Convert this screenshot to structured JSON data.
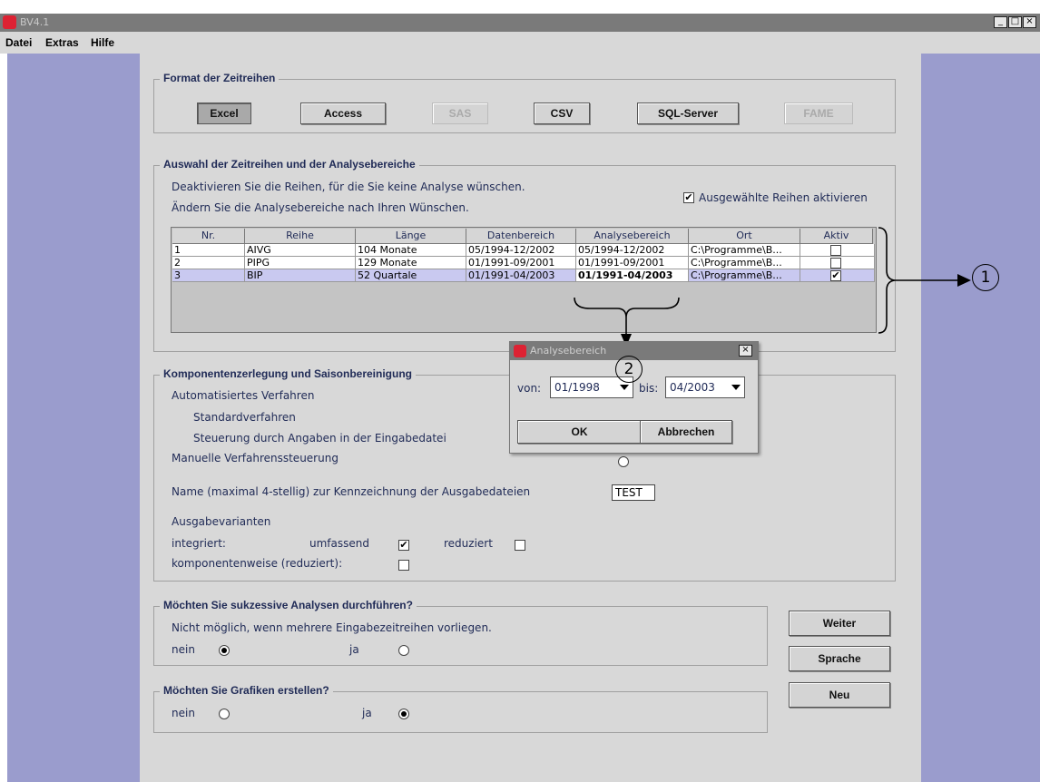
{
  "window": {
    "title": "BV4.1",
    "min": "_",
    "max": "□",
    "close": "×"
  },
  "menu": [
    "Datei",
    "Extras",
    "Hilfe"
  ],
  "format": {
    "title": "Format der Zeitreihen",
    "buttons": [
      "Excel",
      "Access",
      "SAS",
      "CSV",
      "SQL-Server",
      "FAME"
    ]
  },
  "selection": {
    "title": "Auswahl der Zeitreihen und der Analysebereiche",
    "line1": "Deaktivieren Sie die Reihen, für die Sie keine Analyse wünschen.",
    "line2": "Ändern Sie die Analysebereiche nach Ihren Wünschen.",
    "activate_label": "Ausgewählte Reihen aktivieren",
    "columns": [
      "Nr.",
      "Reihe",
      "Länge",
      "Datenbereich",
      "Analysebereich",
      "Ort",
      "Aktiv"
    ],
    "rows": [
      {
        "nr": "1",
        "reihe": "AIVG",
        "laenge": "104 Monate",
        "daten": "05/1994-12/2002",
        "analyse": "05/1994-12/2002",
        "ort": "C:\\Programme\\B...",
        "aktiv": false
      },
      {
        "nr": "2",
        "reihe": "PIPG",
        "laenge": "129 Monate",
        "daten": "01/1991-09/2001",
        "analyse": "01/1991-09/2001",
        "ort": "C:\\Programme\\B...",
        "aktiv": false
      },
      {
        "nr": "3",
        "reihe": "BIP",
        "laenge": "52 Quartale",
        "daten": "01/1991-04/2003",
        "analyse": "01/1991-04/2003",
        "ort": "C:\\Programme\\B...",
        "aktiv": true
      }
    ]
  },
  "komponenten": {
    "title": "Komponentenzerlegung und Saisonbereinigung",
    "auto": "Automatisiertes Verfahren",
    "standard": "Standardverfahren",
    "steuerung": "Steuerung durch Angaben in der Eingabedatei",
    "manuell": "Manuelle Verfahrenssteuerung",
    "name_label": "Name (maximal 4-stellig) zur Kennzeichnung der Ausgabedateien",
    "name_value": "TEST",
    "ausgabe": "Ausgabevarianten",
    "integriert": "integriert:",
    "umfassend": "umfassend",
    "reduziert": "reduziert",
    "komponentenweise": "komponentenweise (reduziert):"
  },
  "sukzessiv": {
    "title": "Möchten Sie sukzessive Analysen durchführen?",
    "hint": "Nicht möglich, wenn mehrere Eingabezeitreihen vorliegen.",
    "nein": "nein",
    "ja": "ja"
  },
  "grafiken": {
    "title": "Möchten Sie Grafiken erstellen?",
    "nein": "nein",
    "ja": "ja"
  },
  "side_buttons": [
    "Weiter",
    "Sprache",
    "Neu"
  ],
  "dialog": {
    "title": "Analysebereich",
    "von_label": "von:",
    "von_value": "01/1998",
    "bis_label": "bis:",
    "bis_value": "04/2003",
    "ok": "OK",
    "cancel": "Abbrechen"
  },
  "callouts": [
    "1",
    "2"
  ]
}
